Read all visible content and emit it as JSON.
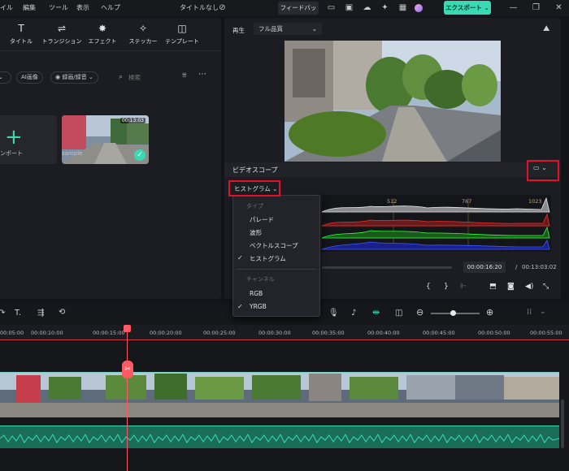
{
  "menubar": {
    "items": [
      "イル",
      "編集",
      "ツール",
      "表示",
      "ヘルプ"
    ],
    "project_title": "タイトルなし",
    "feedback_label": "フィードバック",
    "export_label": "エクスポート"
  },
  "toolbar": {
    "tools": [
      {
        "label": "タイトル",
        "icon": "title-icon"
      },
      {
        "label": "トランジション",
        "icon": "transition-icon"
      },
      {
        "label": "エフェクト",
        "icon": "effect-icon"
      },
      {
        "label": "ステッカー",
        "icon": "sticker-icon"
      },
      {
        "label": "テンプレート",
        "icon": "template-icon"
      }
    ]
  },
  "filters": {
    "ai_image": "AI画像",
    "recording": "録画/録音",
    "search_placeholder": "検索"
  },
  "media": {
    "import_label": "ンポート",
    "clip_name": "sample",
    "clip_duration": "00:13:03"
  },
  "preview": {
    "play_label": "再生",
    "quality": "フル品質",
    "scope_title": "ビデオスコープ",
    "scope_mode": "ヒストグラム",
    "scale_labels": [
      "512",
      "767",
      "1023"
    ],
    "current_time": "00:00:16:20",
    "total_time": "00:13:03:02",
    "time_sep": "/"
  },
  "dropdown": {
    "type_heading": "タイプ",
    "types": [
      "パレード",
      "波形",
      "ベクトルスコープ",
      "ヒストグラム"
    ],
    "selected_type": "ヒストグラム",
    "channel_heading": "チャンネル",
    "channels": [
      "RGB",
      "YRGB"
    ],
    "selected_channel": "YRGB"
  },
  "timeline": {
    "ruler": [
      "00:05:00",
      "00:00:10:00",
      "00:00:15:00",
      "00:00:20:00",
      "00:00:25:00",
      "00:00:30:00",
      "00:00:35:00",
      "00:00:40:00",
      "00:00:45:00",
      "00:00:50:00",
      "00:00:55:00"
    ],
    "playhead_color": "#ff5a63"
  },
  "colors": {
    "accent": "#39d9b4",
    "highlight": "#e3102a",
    "audio": "#2fb592"
  }
}
